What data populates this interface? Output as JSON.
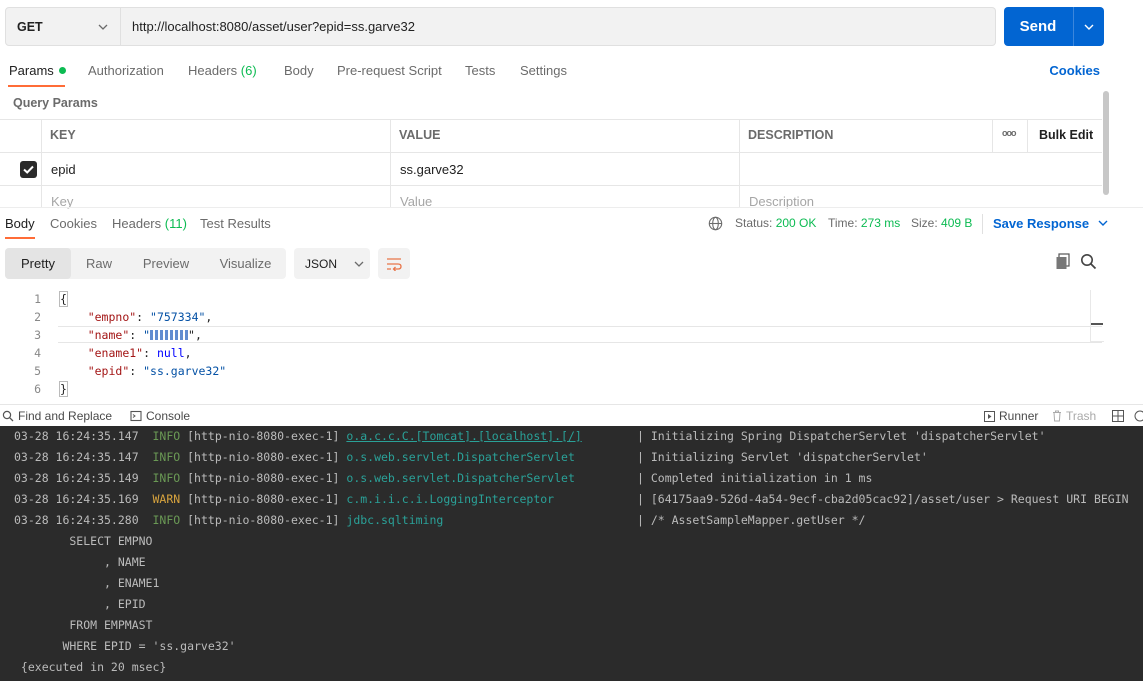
{
  "request": {
    "method": "GET",
    "url": "http://localhost:8080/asset/user?epid=ss.garve32",
    "send_label": "Send"
  },
  "request_tabs": [
    {
      "label": "Params"
    },
    {
      "label": "Authorization"
    },
    {
      "label": "Headers",
      "count": "(6)"
    },
    {
      "label": "Body"
    },
    {
      "label": "Pre-request Script"
    },
    {
      "label": "Tests"
    },
    {
      "label": "Settings"
    }
  ],
  "cookies_label": "Cookies",
  "query_params": {
    "title": "Query Params",
    "headers": [
      "KEY",
      "VALUE",
      "DESCRIPTION"
    ],
    "bulk_edit": "Bulk Edit",
    "more": "ooo",
    "rows": [
      {
        "key": "epid",
        "value": "ss.garve32",
        "description": "",
        "checked": true
      }
    ],
    "placeholder": {
      "key": "Key",
      "value": "Value",
      "description": "Description"
    }
  },
  "response_tabs": [
    {
      "label": "Body"
    },
    {
      "label": "Cookies"
    },
    {
      "label": "Headers",
      "count": "(11)"
    },
    {
      "label": "Test Results"
    }
  ],
  "response_status": {
    "status_label": "Status:",
    "status": "200 OK",
    "time_label": "Time:",
    "time": "273 ms",
    "size_label": "Size:",
    "size": "409 B",
    "save_label": "Save Response"
  },
  "view_modes": [
    "Pretty",
    "Raw",
    "Preview",
    "Visualize"
  ],
  "format": "JSON",
  "body_lines": [
    {
      "n": "1",
      "text": "{"
    },
    {
      "n": "2",
      "key": "\"empno\"",
      "val": "\"757334\"",
      "tail": ","
    },
    {
      "n": "3",
      "key": "\"name\"",
      "val": "\"",
      "tail": "\","
    },
    {
      "n": "4",
      "key": "\"ename1\"",
      "val": "null",
      "tail": ","
    },
    {
      "n": "5",
      "key": "\"epid\"",
      "val": "\"ss.garve32\"",
      "tail": ""
    },
    {
      "n": "6",
      "text": "}"
    }
  ],
  "bottom_bar": {
    "find_replace": "Find and Replace",
    "console": "Console",
    "runner": "Runner",
    "trash": "Trash"
  },
  "console_log": [
    {
      "ts": "03-28 16:24:35.147",
      "level": "INFO",
      "thread": "[http-nio-8080-exec-1]",
      "logger": "o.a.c.c.C.[Tomcat].[localhost].[/]",
      "msg": "| Initializing Spring DispatcherServlet 'dispatcherServlet'"
    },
    {
      "ts": "03-28 16:24:35.147",
      "level": "INFO",
      "thread": "[http-nio-8080-exec-1]",
      "logger": "o.s.web.servlet.DispatcherServlet",
      "msg": "| Initializing Servlet 'dispatcherServlet'"
    },
    {
      "ts": "03-28 16:24:35.149",
      "level": "INFO",
      "thread": "[http-nio-8080-exec-1]",
      "logger": "o.s.web.servlet.DispatcherServlet",
      "msg": "| Completed initialization in 1 ms"
    },
    {
      "ts": "03-28 16:24:35.169",
      "level": "WARN",
      "thread": "[http-nio-8080-exec-1]",
      "logger": "c.m.i.i.c.i.LoggingInterceptor",
      "msg": "| [64175aa9-526d-4a54-9ecf-cba2d05cac92]/asset/user > Request URI BEGIN"
    },
    {
      "ts": "03-28 16:24:35.280",
      "level": "INFO",
      "thread": "[http-nio-8080-exec-1]",
      "logger": "jdbc.sqltiming",
      "msg": "| /* AssetSampleMapper.getUser */"
    }
  ],
  "sql_lines": [
    "        SELECT EMPNO",
    "             , NAME",
    "             , ENAME1",
    "             , EPID",
    "        FROM EMPMAST",
    "       WHERE EPID = 'ss.garve32'",
    " {executed in 20 msec}"
  ]
}
